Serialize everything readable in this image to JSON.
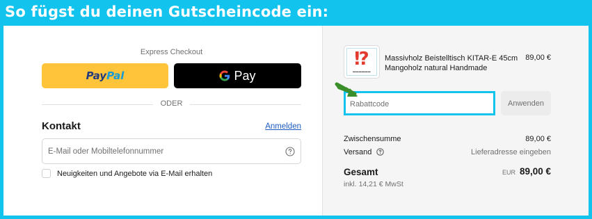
{
  "banner": {
    "title": "So fügst du deinen Gutscheincode ein:"
  },
  "express": {
    "label": "Express Checkout",
    "paypal": {
      "part1": "Pay",
      "part2": "Pal"
    },
    "gpay": {
      "label": "Pay"
    },
    "divider": "ODER"
  },
  "contact": {
    "heading": "Kontakt",
    "login_link": "Anmelden",
    "email_placeholder": "E-Mail oder Mobiltelefonnummer",
    "newsletter_label": "Neuigkeiten und Angebote via E-Mail erhalten"
  },
  "order": {
    "product": {
      "name_line1": "Massivholz Beistelltisch KITAR-E 45cm",
      "name_line2": "Mangoholz natural Handmade",
      "price": "89,00 €",
      "thumb_glyph": "⁉"
    },
    "discount": {
      "placeholder": "Rabattcode",
      "apply_label": "Anwenden"
    },
    "subtotal": {
      "label": "Zwischensumme",
      "value": "89,00 €"
    },
    "shipping": {
      "label": "Versand",
      "value": "Lieferadresse eingeben"
    },
    "total": {
      "label": "Gesamt",
      "currency": "EUR",
      "value": "89,00 €",
      "vat_note": "inkl. 14,21 € MwSt"
    }
  },
  "colors": {
    "frame": "#12c3ee",
    "paypal_yellow": "#ffc439",
    "link_blue": "#1c5bc1",
    "arrow_green": "#3a8f2a"
  }
}
